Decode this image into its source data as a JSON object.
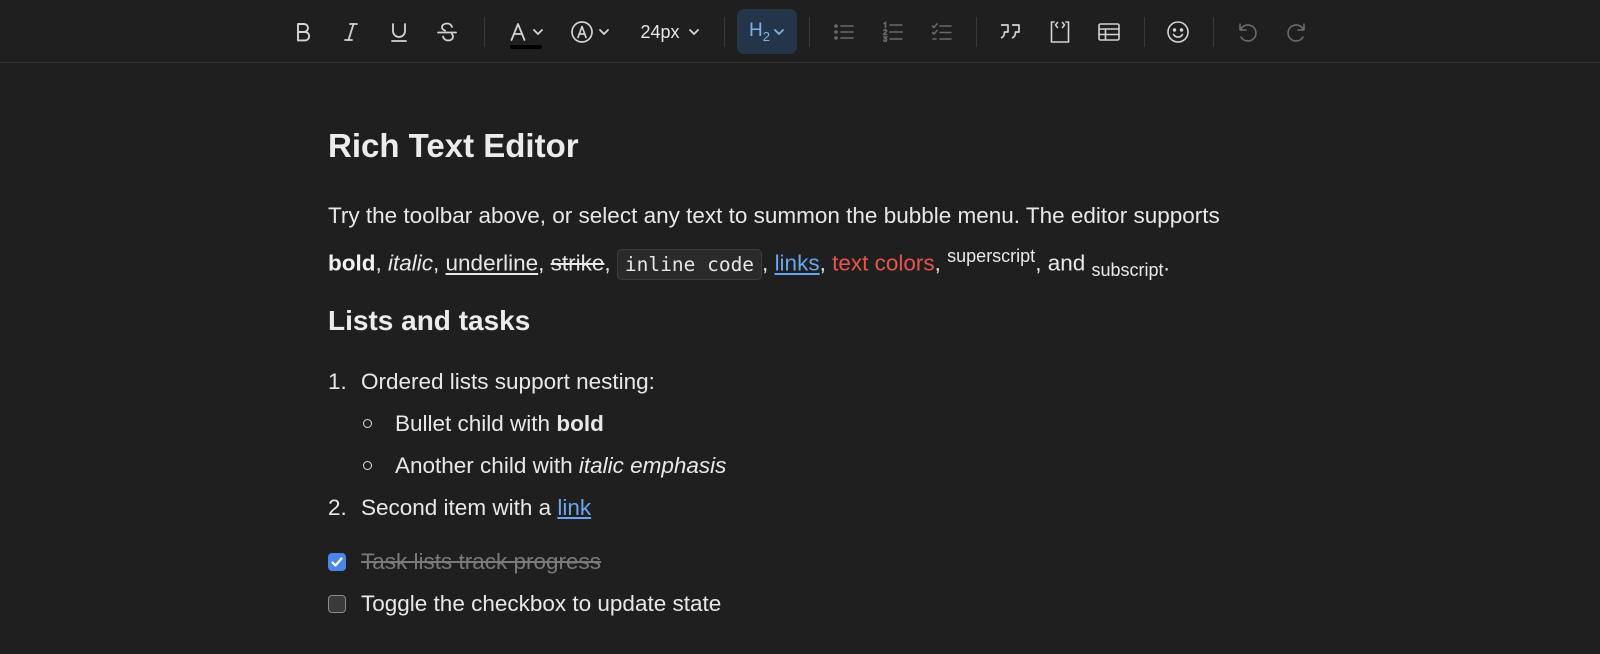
{
  "toolbar": {
    "buttons": [
      {
        "name": "bold",
        "icon": "bold-icon"
      },
      {
        "name": "italic",
        "icon": "italic-icon"
      },
      {
        "name": "underline",
        "icon": "underline-icon"
      },
      {
        "name": "strikethrough",
        "icon": "strikethrough-icon"
      },
      {
        "name": "text-color",
        "icon": "text-color-icon"
      },
      {
        "name": "highlight",
        "icon": "highlight-icon"
      },
      {
        "name": "font-size",
        "icon": "chevron-down-icon"
      },
      {
        "name": "heading",
        "icon": "heading-icon"
      },
      {
        "name": "bullet-list",
        "icon": "bullet-list-icon"
      },
      {
        "name": "ordered-list",
        "icon": "ordered-list-icon"
      },
      {
        "name": "task-list",
        "icon": "task-list-icon"
      },
      {
        "name": "blockquote",
        "icon": "quote-icon"
      },
      {
        "name": "code-block",
        "icon": "code-block-icon"
      },
      {
        "name": "table",
        "icon": "table-icon"
      },
      {
        "name": "emoji",
        "icon": "smile-icon"
      },
      {
        "name": "undo",
        "icon": "undo-icon"
      },
      {
        "name": "redo",
        "icon": "redo-icon"
      }
    ],
    "font_size": "24px",
    "heading_level": "H",
    "heading_sub": "2",
    "text_color_swatch": "#000000",
    "active_color": "#7fb0ee"
  },
  "doc": {
    "title": "Rich Text Editor",
    "intro": {
      "lead": "Try the toolbar above, or select any text to summon the bubble menu. The editor supports",
      "bold": "bold",
      "italic": "italic",
      "underline": "underline",
      "strike": "strike",
      "code": "inline code",
      "links": "links",
      "colors": "text colors",
      "superscript": "superscript",
      "and": ", and",
      "subscript": "subscript",
      "end": "."
    },
    "section_title": "Lists and tasks",
    "list": {
      "item1": {
        "num": "1.",
        "text": "Ordered lists support nesting:"
      },
      "child1": {
        "text": "Bullet child with",
        "bold": "bold"
      },
      "child2": {
        "text": "Another child with",
        "italic": "italic emphasis"
      },
      "item2": {
        "num": "2.",
        "text": "Second item with a",
        "link": "link"
      }
    },
    "tasks": [
      {
        "text": "Task lists track progress",
        "checked": true
      },
      {
        "text": "Toggle the checkbox to update state",
        "checked": false
      }
    ]
  },
  "colors": {
    "background": "#1f1f1f",
    "link": "#6aa6f0",
    "red_text": "#e5564f",
    "checkbox_checked": "#4a86e8"
  }
}
